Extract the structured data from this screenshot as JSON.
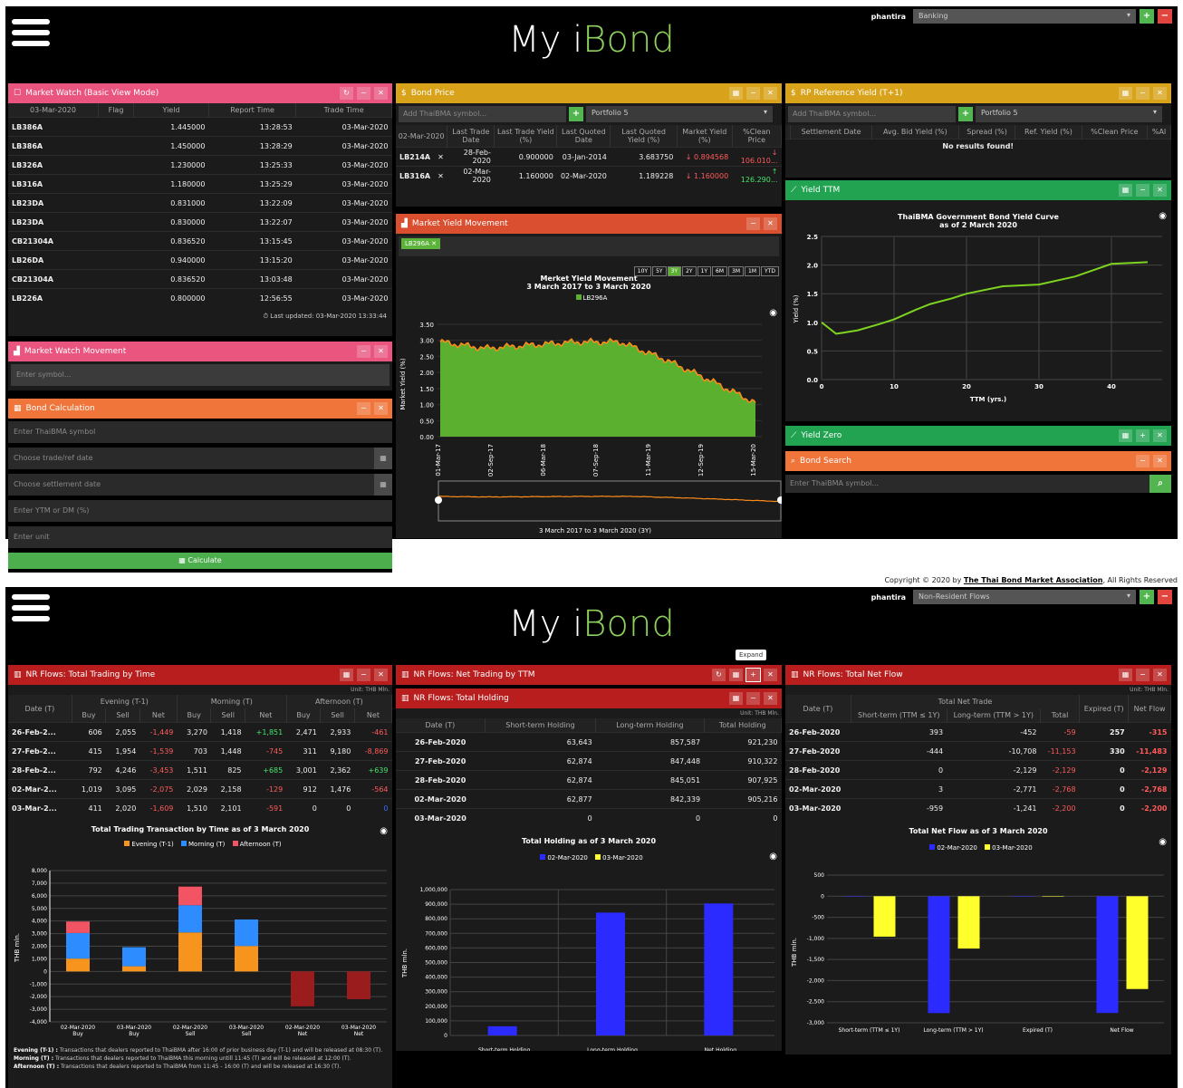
{
  "app": {
    "title_a": "My i",
    "title_b": "Bond"
  },
  "screen1": {
    "user": "phantira",
    "dropdown": "Banking",
    "market_watch": {
      "title": "Market Watch (Basic View Mode)",
      "columns": [
        "03-Mar-2020",
        "Flag",
        "Yield",
        "Report Time",
        "Trade Time"
      ],
      "rows": [
        [
          "LB386A",
          "",
          "1.445000",
          "13:28:53",
          "03-Mar-2020"
        ],
        [
          "LB386A",
          "",
          "1.450000",
          "13:28:29",
          "03-Mar-2020"
        ],
        [
          "LB326A",
          "",
          "1.230000",
          "13:25:33",
          "03-Mar-2020"
        ],
        [
          "LB316A",
          "",
          "1.180000",
          "13:25:29",
          "03-Mar-2020"
        ],
        [
          "LB23DA",
          "",
          "0.831000",
          "13:22:09",
          "03-Mar-2020"
        ],
        [
          "LB23DA",
          "",
          "0.830000",
          "13:22:07",
          "03-Mar-2020"
        ],
        [
          "CB21304A",
          "",
          "0.836520",
          "13:15:45",
          "03-Mar-2020"
        ],
        [
          "LB26DA",
          "",
          "0.940000",
          "13:15:20",
          "03-Mar-2020"
        ],
        [
          "CB21304A",
          "",
          "0.836520",
          "13:03:48",
          "03-Mar-2020"
        ],
        [
          "LB226A",
          "",
          "0.800000",
          "12:56:55",
          "03-Mar-2020"
        ]
      ],
      "updated": "Last updated: 03-Mar-2020 13:33:44"
    },
    "mw_movement": {
      "title": "Market Watch Movement",
      "placeholder": "Enter symbol..."
    },
    "bond_calc": {
      "title": "Bond Calculation",
      "f1": "Enter ThaiBMA symbol",
      "f2": "Choose trade/ref date",
      "f3": "Choose settlement date",
      "f4": "Enter YTM or DM (%)",
      "f5": "Enter unit",
      "button": "Calculate"
    },
    "bond_price": {
      "title": "Bond Price",
      "placeholder": "Add ThaiBMA symbol...",
      "portfolio": "Portfolio 5",
      "columns": [
        "02-Mar-2020",
        "Last Trade Date",
        "Last Trade Yield (%)",
        "Last Quoted Date",
        "Last Quoted Yield (%)",
        "Market Yield (%)",
        "%Clean Price"
      ],
      "rows": [
        [
          "LB214A",
          "28-Feb-2020",
          "0.900000",
          "03-Jan-2014",
          "3.683750",
          "↓ 0.894568",
          "↓ 106.010..."
        ],
        [
          "LB316A",
          "02-Mar-2020",
          "1.160000",
          "02-Mar-2020",
          "1.189228",
          "↓ 1.160000",
          "↑ 126.290..."
        ]
      ]
    },
    "myield": {
      "title": "Market Yield Movement",
      "tag": "LB296A",
      "ranges": [
        "10Y",
        "5Y",
        "3Y",
        "2Y",
        "1Y",
        "6M",
        "3M",
        "1M",
        "YTD"
      ],
      "chart_title": "Merket Yield Movement",
      "chart_sub": "3 March 2017 to 3 March 2020",
      "legend": "LB296A",
      "ylabel": "Market Yield (%)",
      "yticks": [
        "3.50",
        "3.00",
        "2.50",
        "2.00",
        "1.50",
        "1.00",
        "0.50",
        "0.00"
      ],
      "xticks": [
        "01-Mar-17",
        "02-Sep-17",
        "06-Mar-18",
        "07-Sep-18",
        "11-Mar-19",
        "12-Sep-19",
        "15-Mar-20"
      ],
      "nav_label": "3 March 2017 to 3 March 2020 (3Y)"
    },
    "rp": {
      "title": "RP Reference Yield (T+1)",
      "placeholder": "Add ThaiBMA symbol...",
      "portfolio": "Portfolio 5",
      "columns": [
        "",
        "Settlement Date",
        "Avg. Bid Yield (%)",
        "Spread (%)",
        "Ref. Yield (%)",
        "%Clean Price",
        "%AI"
      ],
      "empty": "No results found!"
    },
    "yield_ttm": {
      "title": "Yield TTM",
      "chart_title": "ThaiBMA Government Bond Yield Curve",
      "chart_sub": "as of 2 March 2020",
      "ylabel": "Yield (%)",
      "xlabel": "TTM (yrs.)",
      "yticks": [
        "2.5",
        "2.0",
        "1.5",
        "1.0",
        "0.5",
        "0.0"
      ],
      "xticks": [
        "0",
        "10",
        "20",
        "30",
        "40"
      ]
    },
    "yield_zero": {
      "title": "Yield Zero"
    },
    "bond_search": {
      "title": "Bond Search",
      "placeholder": "Enter ThaiBMA symbol..."
    }
  },
  "copyright": {
    "text": "Copyright © 2020 by ",
    "org": "The Thai Bond Market Association",
    "rights": ", All Rights Reserved"
  },
  "screen2": {
    "user": "phantira",
    "dropdown": "Non-Resident Flows",
    "tooltip": "Expand",
    "nr_time": {
      "title": "NR Flows: Total Trading by Time",
      "unit": "Unit: THB Mln.",
      "groups": [
        "Evening (T-1)",
        "Morning (T)",
        "Afternoon (T)"
      ],
      "sub": [
        "Buy",
        "Sell",
        "Net"
      ],
      "datecol": "Date (T)",
      "rows": [
        [
          "26-Feb-2...",
          "606",
          "2,055",
          "-1,449",
          "3,270",
          "1,418",
          "+1,851",
          "2,471",
          "2,933",
          "-461"
        ],
        [
          "27-Feb-2...",
          "415",
          "1,954",
          "-1,539",
          "703",
          "1,448",
          "-745",
          "311",
          "9,180",
          "-8,869"
        ],
        [
          "28-Feb-2...",
          "792",
          "4,246",
          "-3,453",
          "1,511",
          "825",
          "+685",
          "3,001",
          "2,362",
          "+639"
        ],
        [
          "02-Mar-2...",
          "1,019",
          "3,095",
          "-2,075",
          "2,029",
          "2,158",
          "-129",
          "912",
          "1,476",
          "-564"
        ],
        [
          "03-Mar-2...",
          "411",
          "2,020",
          "-1,609",
          "1,510",
          "2,101",
          "-591",
          "0",
          "0",
          "0"
        ]
      ],
      "chart_title": "Total Trading Transaction by Time as of 3 March 2020",
      "legend": [
        "Evening (T-1)",
        "Morning (T)",
        "Afternoon (T)"
      ],
      "ylabel": "THB mln.",
      "notes": [
        [
          "Evening (T-1) :",
          "Transactions that dealers reported to ThaiBMA after 16:00 of prior business day (T-1) and will be released at 08:30 (T)."
        ],
        [
          "Morning (T) :",
          "Transactions that dealers reported to ThaiBMA this morning untill 11:45 (T) and will be released at 12:00 (T)."
        ],
        [
          "Afternoon (T) :",
          "Transactions that dealers reported to ThaiBMA from 11:45 - 16:00 (T) and will be released at 16:30 (T)."
        ]
      ]
    },
    "nr_ttm": {
      "title": "NR Flows: Net Trading by TTM"
    },
    "nr_hold": {
      "title": "NR Flows: Total Holding",
      "unit": "Unit: THB Mln.",
      "columns": [
        "Date (T)",
        "Short-term Holding",
        "Long-term Holding",
        "Total Holding"
      ],
      "rows": [
        [
          "26-Feb-2020",
          "63,643",
          "857,587",
          "921,230"
        ],
        [
          "27-Feb-2020",
          "62,874",
          "847,448",
          "910,322"
        ],
        [
          "28-Feb-2020",
          "62,874",
          "845,051",
          "907,925"
        ],
        [
          "02-Mar-2020",
          "62,877",
          "842,339",
          "905,216"
        ],
        [
          "03-Mar-2020",
          "0",
          "0",
          "0"
        ]
      ],
      "chart_title": "Total Holding as of 3 March 2020",
      "legend": [
        "02-Mar-2020",
        "03-Mar-2020"
      ],
      "ylabel": "THB mln."
    },
    "nr_net": {
      "title": "NR Flows: Total Net Flow",
      "unit": "Unit: THB Mln.",
      "columns": [
        "Date (T)",
        "Total Net Trade",
        "Short-term (TTM ≤ 1Y)",
        "Long-term (TTM > 1Y)",
        "Total",
        "Expired (T)",
        "Net Flow"
      ],
      "rows": [
        [
          "26-Feb-2020",
          "393",
          "-452",
          "-59",
          "257",
          "-315"
        ],
        [
          "27-Feb-2020",
          "-444",
          "-10,708",
          "-11,153",
          "330",
          "-11,483"
        ],
        [
          "28-Feb-2020",
          "0",
          "-2,129",
          "-2,129",
          "0",
          "-2,129"
        ],
        [
          "02-Mar-2020",
          "3",
          "-2,771",
          "-2,768",
          "0",
          "-2,768"
        ],
        [
          "03-Mar-2020",
          "-959",
          "-1,241",
          "-2,200",
          "0",
          "-2,200"
        ]
      ],
      "chart_title": "Total Net Flow as of 3 March 2020",
      "legend": [
        "02-Mar-2020",
        "03-Mar-2020"
      ],
      "ylabel": "THB mln."
    }
  },
  "chart_data": [
    {
      "type": "area",
      "title": "Merket Yield Movement",
      "subtitle": "3 March 2017 to 3 March 2020",
      "ylabel": "Market Yield (%)",
      "ylim": [
        0,
        3.5
      ],
      "x": [
        "01-Mar-17",
        "02-Sep-17",
        "06-Mar-18",
        "07-Sep-18",
        "11-Mar-19",
        "12-Sep-19",
        "15-Mar-20"
      ],
      "series": [
        {
          "name": "LB296A",
          "values": [
            2.95,
            2.75,
            2.85,
            2.95,
            2.95,
            2.4,
            1.75,
            1.05
          ]
        }
      ]
    },
    {
      "type": "line",
      "title": "ThaiBMA Government Bond Yield Curve",
      "subtitle": "as of 2 March 2020",
      "xlabel": "TTM (yrs.)",
      "ylabel": "Yield (%)",
      "xlim": [
        0,
        47
      ],
      "ylim": [
        0,
        2.6
      ],
      "x": [
        0,
        1,
        2,
        3,
        5,
        8,
        10,
        13,
        15,
        18,
        20,
        25,
        30,
        35,
        40,
        45
      ],
      "series": [
        {
          "name": "",
          "values": [
            1.0,
            0.9,
            0.8,
            0.82,
            0.86,
            0.97,
            1.05,
            1.22,
            1.32,
            1.42,
            1.5,
            1.63,
            1.66,
            1.8,
            2.02,
            2.05
          ]
        }
      ]
    },
    {
      "type": "bar",
      "title": "Total Trading Transaction by Time as of 3 March 2020",
      "ylabel": "THB mln.",
      "ylim": [
        -4000,
        8000
      ],
      "categories": [
        "02-Mar-2020 Buy",
        "03-Mar-2020 Buy",
        "02-Mar-2020 Sell",
        "03-Mar-2020 Sell",
        "02-Mar-2020 Net",
        "03-Mar-2020 Net"
      ],
      "series": [
        {
          "name": "Evening (T-1)",
          "values": [
            1019,
            411,
            3095,
            2020,
            0,
            0
          ]
        },
        {
          "name": "Morning (T)",
          "values": [
            2029,
            1510,
            2158,
            2101,
            0,
            0
          ]
        },
        {
          "name": "Afternoon (T)",
          "values": [
            912,
            0,
            1476,
            0,
            0,
            0
          ]
        },
        {
          "name": "Net",
          "values": [
            0,
            0,
            0,
            0,
            -2768,
            -2200
          ]
        }
      ]
    },
    {
      "type": "bar",
      "title": "Total Holding as of 3 March 2020",
      "ylabel": "THB mln.",
      "ylim": [
        0,
        1000000
      ],
      "categories": [
        "Short-term Holding",
        "Long-term Holding",
        "Net Holding"
      ],
      "series": [
        {
          "name": "02-Mar-2020",
          "values": [
            62877,
            842339,
            905216
          ]
        },
        {
          "name": "03-Mar-2020",
          "values": [
            0,
            0,
            0
          ]
        }
      ]
    },
    {
      "type": "bar",
      "title": "Total Net Flow as of 3 March 2020",
      "ylabel": "THB mln.",
      "ylim": [
        -3000,
        500
      ],
      "categories": [
        "Short-term (TTM ≤ 1Y)",
        "Long-term (TTM > 1Y)",
        "Expired (T)",
        "Net Flow"
      ],
      "series": [
        {
          "name": "02-Mar-2020",
          "values": [
            3,
            -2771,
            0,
            -2768
          ]
        },
        {
          "name": "03-Mar-2020",
          "values": [
            -959,
            -1241,
            0,
            -2200
          ]
        }
      ]
    }
  ],
  "colors": {
    "pink": "#e9557f",
    "gold": "#d8a31b",
    "orange": "#f0753a",
    "green": "#22a352",
    "crimson": "#b81e1e",
    "area": "#5cb030",
    "line": "#ff8c1a",
    "curve": "#7ed321",
    "evening": "#f7941d",
    "morning": "#2d8cff",
    "afternoon": "#f25464",
    "net": "#9b1c1c",
    "blue": "#2b2bff",
    "yellow": "#ffff2b"
  }
}
